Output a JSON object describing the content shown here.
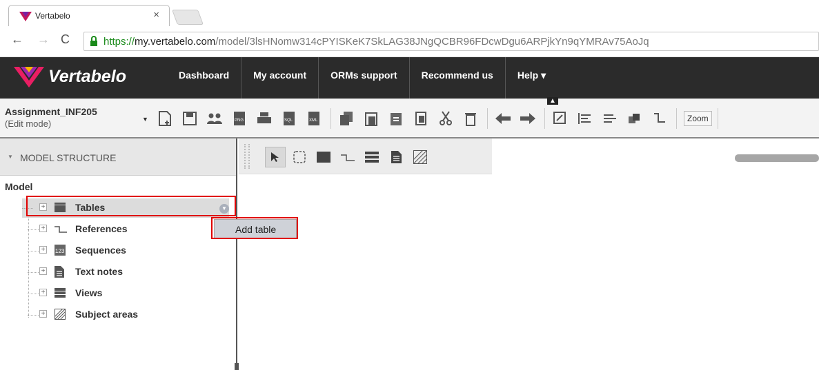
{
  "browser": {
    "tab_title": "Vertabelo",
    "tab_close": "×",
    "url_scheme": "https://",
    "url_host": "my.vertabelo.com",
    "url_path": "/model/3lsHNomw314cPYISKeK7SkLAG38JNgQCBR96FDcwDgu6ARPjkYn9qYMRAv75AoJq"
  },
  "appnav": {
    "logo": "Vertabelo",
    "links": [
      "Dashboard",
      "My account",
      "ORMs support",
      "Recommend us",
      "Help ▾"
    ]
  },
  "toolbar": {
    "model_name": "Assignment_INF205",
    "mode": "(Edit mode)",
    "zoom_label": "Zoom",
    "icons": [
      "new-document-icon",
      "save-icon",
      "users-icon",
      "png-icon",
      "print-icon",
      "sql-icon",
      "xml-icon",
      "copy-icon",
      "paste-icon",
      "paste-special-icon",
      "cut-icon",
      "delete-icon",
      "undo-arrow-icon",
      "redo-arrow-icon",
      "edit-icon",
      "align-left-icon",
      "align-right-icon",
      "layer-icon",
      "reference-icon"
    ]
  },
  "sidebar": {
    "header": "MODEL STRUCTURE",
    "root": "Model",
    "items": [
      {
        "label": "Tables",
        "icon": "table-icon"
      },
      {
        "label": "References",
        "icon": "reference-icon"
      },
      {
        "label": "Sequences",
        "icon": "sequence-icon"
      },
      {
        "label": "Text notes",
        "icon": "text-note-icon"
      },
      {
        "label": "Views",
        "icon": "view-icon"
      },
      {
        "label": "Subject areas",
        "icon": "subject-area-icon"
      }
    ]
  },
  "context_menu": {
    "add_table": "Add table"
  },
  "colors": {
    "nav_bg": "#2b2b2b",
    "highlight": "#e00000",
    "https_green": "#1a8a1a"
  }
}
